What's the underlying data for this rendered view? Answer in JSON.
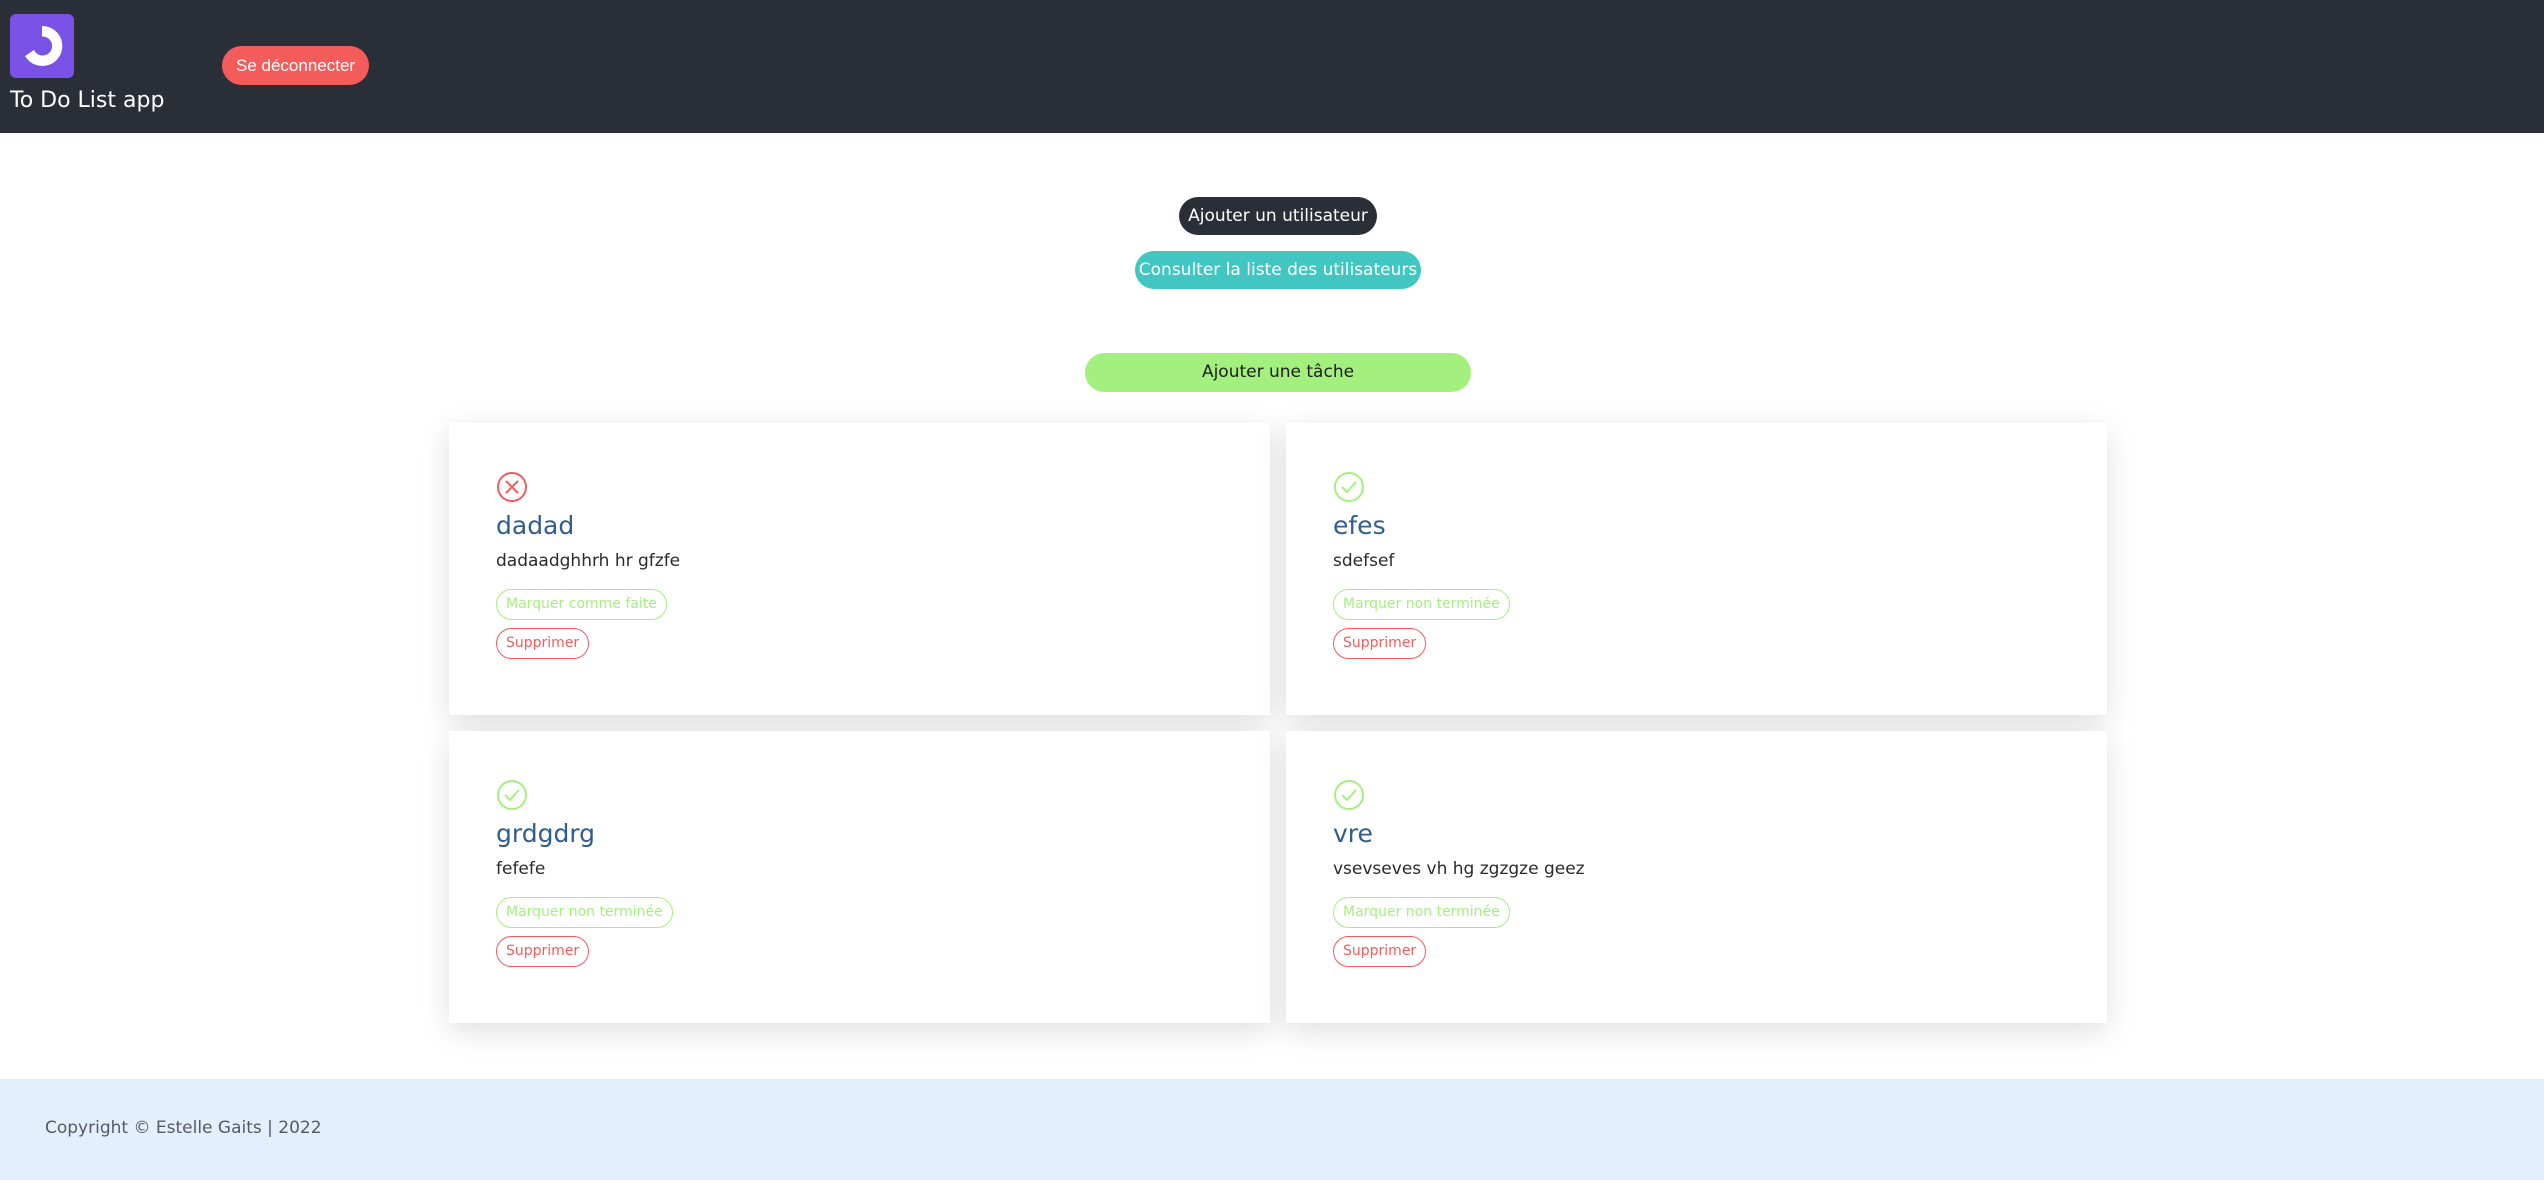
{
  "header": {
    "logo_icon": "app-logo-icon",
    "app_name": "To Do List app",
    "logout_label": "Se déconnecter"
  },
  "actions": {
    "add_user_label": "Ajouter un utilisateur",
    "list_users_label": "Consulter la liste des utilisateurs",
    "add_task_label": "Ajouter une tâche"
  },
  "tasks": [
    {
      "status": "not-done",
      "status_icon": "x-circle-icon",
      "title": "dadad",
      "description": "dadaadghhrh hr gfzfe",
      "toggle_label": "Marquer comme faite",
      "delete_label": "Supprimer"
    },
    {
      "status": "done",
      "status_icon": "check-circle-icon",
      "title": "efes",
      "description": "sdefsef",
      "toggle_label": "Marquer non terminée",
      "delete_label": "Supprimer"
    },
    {
      "status": "done",
      "status_icon": "check-circle-icon",
      "title": "grdgdrg",
      "description": "fefefe",
      "toggle_label": "Marquer non terminée",
      "delete_label": "Supprimer"
    },
    {
      "status": "done",
      "status_icon": "check-circle-icon",
      "title": "vre",
      "description": "vsevseves vh hg zgzgze geez",
      "toggle_label": "Marquer non terminée",
      "delete_label": "Supprimer"
    }
  ],
  "footer": {
    "copyright": "Copyright © Estelle Gaits | 2022"
  },
  "colors": {
    "header_bg": "#2a2e37",
    "logo_bg": "#7a52e6",
    "danger": "#f45b5b",
    "success": "#a4f07f",
    "teal": "#42c6c2",
    "title_blue": "#2f5d8c",
    "footer_bg": "#e3effc"
  }
}
